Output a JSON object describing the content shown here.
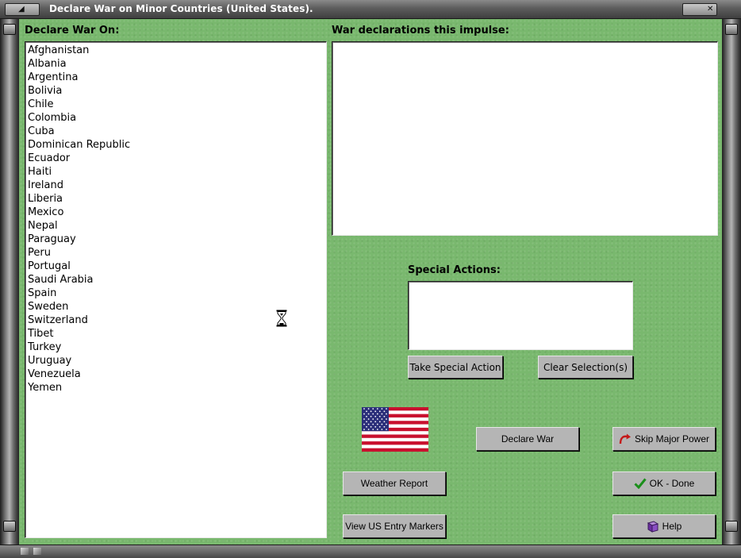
{
  "window": {
    "title": "Declare War on Minor Countries (United States)."
  },
  "left_panel": {
    "label": "Declare War On:",
    "countries": [
      "Afghanistan",
      "Albania",
      "Argentina",
      "Bolivia",
      "Chile",
      "Colombia",
      "Cuba",
      "Dominican Republic",
      "Ecuador",
      "Haiti",
      "Ireland",
      "Liberia",
      "Mexico",
      "Nepal",
      "Paraguay",
      "Peru",
      "Portugal",
      "Saudi Arabia",
      "Spain",
      "Sweden",
      "Switzerland",
      "Tibet",
      "Turkey",
      "Uruguay",
      "Venezuela",
      "Yemen"
    ]
  },
  "right_panel": {
    "declarations_label": "War declarations this impulse:",
    "declarations": [],
    "special_actions_label": "Special Actions:",
    "special_actions": []
  },
  "buttons": {
    "take_special_action": "Take Special Action",
    "clear_selections": "Clear Selection(s)",
    "declare_war": "Declare War",
    "skip_major_power": "Skip Major Power",
    "weather_report": "Weather Report",
    "ok_done": "OK - Done",
    "view_us_entry_markers": "View US Entry Markers",
    "help": "Help"
  },
  "icons": {
    "flag": "us-flag-icon",
    "cursor": "hourglass-cursor-icon",
    "skip": "skip-arrow-icon",
    "ok": "checkmark-icon",
    "help": "help-book-icon"
  },
  "colors": {
    "background": "#79b86e",
    "button": "#b5b5b5",
    "title_bar": "#5d5d5d",
    "checkmark": "#1a8f1a",
    "skip_arrow": "#c41a1a"
  }
}
